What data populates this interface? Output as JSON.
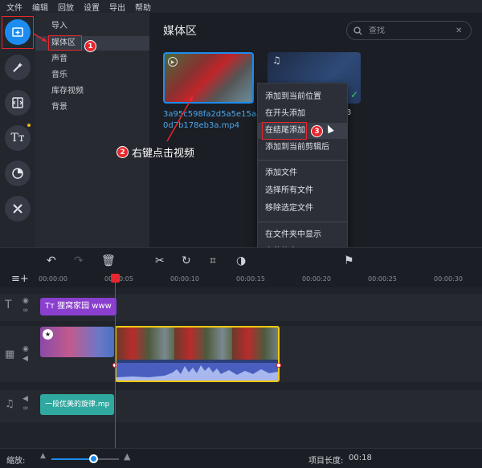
{
  "menu": [
    "文件",
    "编辑",
    "回放",
    "设置",
    "导出",
    "帮助"
  ],
  "sidebar_icons": [
    "import-media-icon",
    "magic-wand-icon",
    "transitions-icon",
    "titles-icon",
    "stickers-icon",
    "tools-icon"
  ],
  "subnav": {
    "items": [
      "导入",
      "媒体区",
      "声音",
      "音乐",
      "库存视频",
      "背景"
    ],
    "active_index": 1
  },
  "media": {
    "title": "媒体区",
    "search_placeholder": "查找",
    "file1_name": "3a95c598fa2d5a5e15aa0d7b178eb3a.mp4",
    "file2_suffix": "3"
  },
  "context_menu": {
    "group1": [
      "添加到当前位置",
      "在开头添加",
      "在结尾添加",
      "添加到当前剪辑后"
    ],
    "group2": [
      "添加文件",
      "选择所有文件",
      "移除选定文件"
    ],
    "group3": [
      "在文件夹中显示",
      "文件信息"
    ],
    "highlighted": "在结尾添加"
  },
  "annotations": {
    "badge1": "1",
    "badge2": "2",
    "badge3": "3",
    "hint": "右键点击视频"
  },
  "timeline": {
    "ticks": [
      "00:00:00",
      "00:00:05",
      "00:00:10",
      "00:00:15",
      "00:00:20",
      "00:00:25",
      "00:00:30"
    ],
    "title_clip": "狸窝家园 www",
    "audio_clip": "一段优美的旋律.mp"
  },
  "status": {
    "zoom_label": "缩放:",
    "zoom_level": 0.62,
    "project_length_label": "项目长度:",
    "project_length": "00:18"
  },
  "colors": {
    "accent": "#1d8cf0",
    "annotation_red": "#e8262e",
    "selection_yellow": "#f2c811",
    "title_clip": "#8a3fcf",
    "audio_clip": "#2fa8a0"
  }
}
